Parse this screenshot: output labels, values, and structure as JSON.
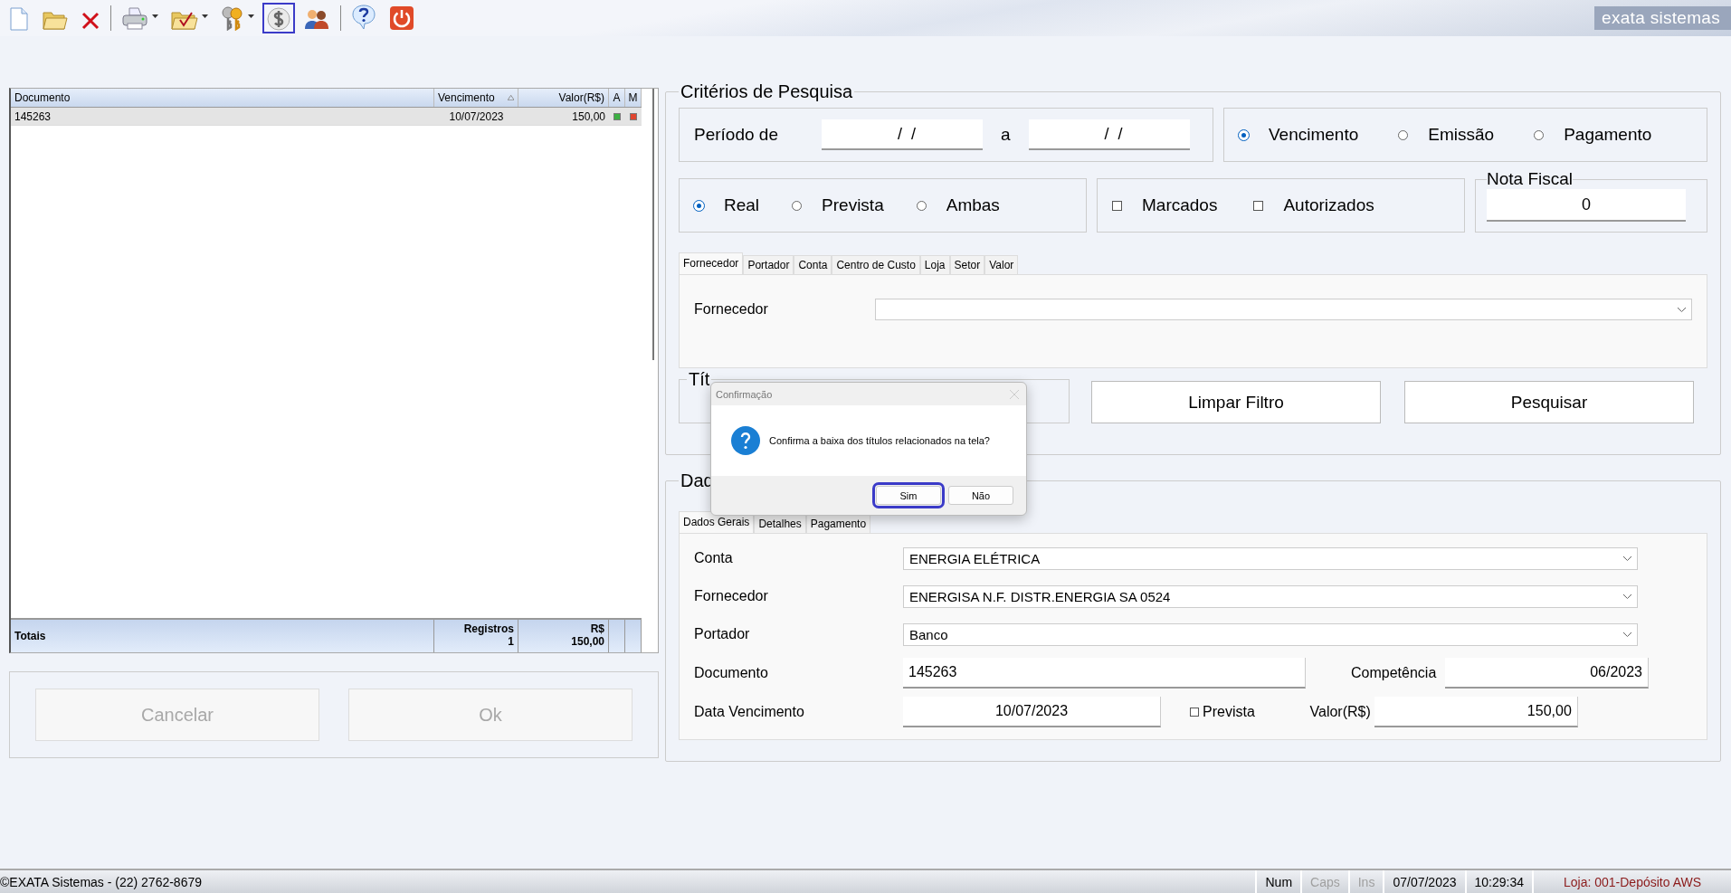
{
  "toolbar": {
    "items": [
      {
        "kind": "new",
        "selected": false,
        "dropdown": false
      },
      {
        "kind": "open",
        "selected": false,
        "dropdown": false
      },
      {
        "kind": "delete",
        "selected": false,
        "dropdown": false
      },
      {
        "kind": "print",
        "selected": false,
        "dropdown": true
      },
      {
        "kind": "folder-check",
        "selected": false,
        "dropdown": true
      },
      {
        "kind": "keys",
        "selected": false,
        "dropdown": true
      },
      {
        "kind": "money",
        "selected": true,
        "dropdown": false
      },
      {
        "kind": "users",
        "selected": false,
        "dropdown": false
      },
      {
        "kind": "help",
        "selected": false,
        "dropdown": false
      },
      {
        "kind": "power",
        "selected": false,
        "dropdown": false
      }
    ],
    "brand": "exata sistemas"
  },
  "grid": {
    "columns": [
      {
        "label": "Documento",
        "sorted": false
      },
      {
        "label": "Vencimento",
        "sorted": true
      },
      {
        "label": "Valor(R$)",
        "sorted": false
      },
      {
        "label": "A",
        "sorted": false
      },
      {
        "label": "M",
        "sorted": false
      }
    ],
    "rows": [
      {
        "documento": "145263",
        "vencimento": "10/07/2023",
        "valor": "150,00",
        "status": [
          {
            "color": "#3cb043"
          },
          {
            "color": "#e0452f"
          }
        ],
        "selected": true
      }
    ],
    "totals": {
      "label": "Totais",
      "count_label": "Registros",
      "count": "1",
      "sum_label": "R$",
      "sum": "150,00"
    }
  },
  "buttons": [
    {
      "label": "Cancelar",
      "disabled": true
    },
    {
      "label": "Ok",
      "disabled": true
    }
  ],
  "criteria": {
    "title": "Critérios de Pesquisa",
    "period": {
      "label": "Período de",
      "from": "  /  /",
      "separator": "a",
      "to": "  /  /"
    },
    "date_types": [
      {
        "label": "Vencimento",
        "selected": true
      },
      {
        "label": "Emissão",
        "selected": false
      },
      {
        "label": "Pagamento",
        "selected": false
      }
    ],
    "situations": [
      {
        "label": "Real",
        "selected": true
      },
      {
        "label": "Prevista",
        "selected": false
      },
      {
        "label": "Ambas",
        "selected": false
      }
    ],
    "flags": [
      {
        "label": "Marcados",
        "checked": false
      },
      {
        "label": "Autorizados",
        "checked": false
      }
    ],
    "nota_fiscal": {
      "label": "Nota Fiscal",
      "value": "0"
    },
    "tabs": [
      {
        "label": "Fornecedor",
        "selected": true
      },
      {
        "label": "Portador",
        "selected": false
      },
      {
        "label": "Conta",
        "selected": false
      },
      {
        "label": "Centro de Custo",
        "selected": false
      },
      {
        "label": "Loja",
        "selected": false
      },
      {
        "label": "Setor",
        "selected": false
      },
      {
        "label": "Valor",
        "selected": false
      }
    ],
    "filter_label": "Fornecedor",
    "titulos_legend": "Tít",
    "actions": [
      "Limpar Filtro",
      "Pesquisar"
    ]
  },
  "dados": {
    "legend": "Dad",
    "tabs": [
      {
        "label": "Dados Gerais",
        "selected": true
      },
      {
        "label": "Detalhes",
        "selected": false
      },
      {
        "label": "Pagamento",
        "selected": false
      }
    ],
    "conta": {
      "label": "Conta",
      "value": "ENERGIA ELÉTRICA"
    },
    "fornecedor": {
      "label": "Fornecedor",
      "value": "ENERGISA N.F. DISTR.ENERGIA SA 0524"
    },
    "portador": {
      "label": "Portador",
      "value": "Banco"
    },
    "documento": {
      "label": "Documento",
      "value": "145263"
    },
    "competencia": {
      "label": "Competência",
      "value": "06/2023"
    },
    "vencimento": {
      "label": "Data Vencimento",
      "value": "10/07/2023"
    },
    "prevista": {
      "label": "Prevista",
      "checked": false
    },
    "valor": {
      "label": "Valor(R$)",
      "value": "150,00"
    }
  },
  "dialog": {
    "title": "Confirmação",
    "message": "Confirma a baixa dos títulos relacionados na tela?",
    "buttons": [
      {
        "label": "Sim",
        "selected": true
      },
      {
        "label": "Não",
        "selected": false
      }
    ]
  },
  "status_bar": {
    "copyright": "©EXATA Sistemas - (22) 2762-8679",
    "indicators": [
      {
        "label": "Num",
        "disabled": false
      },
      {
        "label": "Caps",
        "disabled": true
      },
      {
        "label": "Ins",
        "disabled": true
      }
    ],
    "date": "07/07/2023",
    "time": "10:29:34",
    "store": "Loja: 001-Depósito AWS"
  }
}
